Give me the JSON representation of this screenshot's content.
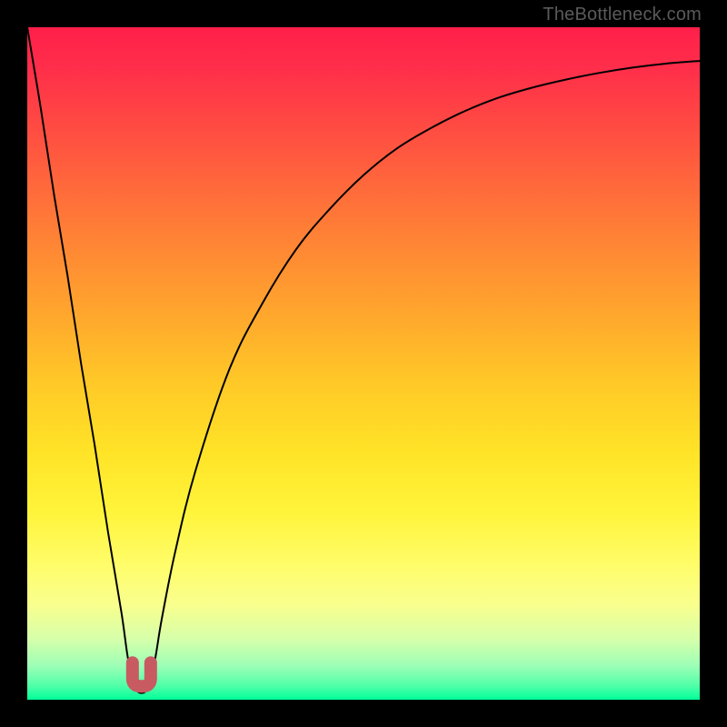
{
  "watermark": "TheBottleneck.com",
  "colors": {
    "background": "#000000",
    "curve": "#000000",
    "marker": "#c85a62",
    "gradient_top": "#ff1f4a",
    "gradient_bottom": "#00ff99"
  },
  "chart_data": {
    "type": "line",
    "title": "",
    "xlabel": "",
    "ylabel": "",
    "xlim": [
      0,
      100
    ],
    "ylim": [
      0,
      100
    ],
    "grid": false,
    "legend": false,
    "series": [
      {
        "name": "bottleneck-curve",
        "x": [
          0,
          2,
          4,
          6,
          8,
          10,
          12,
          14,
          15,
          16,
          17,
          18,
          19,
          20,
          22,
          25,
          30,
          35,
          40,
          45,
          50,
          55,
          60,
          65,
          70,
          75,
          80,
          85,
          90,
          95,
          100
        ],
        "y": [
          100,
          88,
          75,
          63,
          50,
          38,
          25,
          13,
          6,
          2,
          1,
          2,
          6,
          12,
          22,
          34,
          49,
          59,
          67,
          73,
          78,
          82,
          85,
          87.5,
          89.5,
          91,
          92.2,
          93.2,
          94,
          94.6,
          95
        ]
      }
    ],
    "annotations": [
      {
        "name": "minimum-marker",
        "shape": "rounded-u",
        "x": 17,
        "y": 2,
        "color": "#c85a62"
      }
    ]
  }
}
